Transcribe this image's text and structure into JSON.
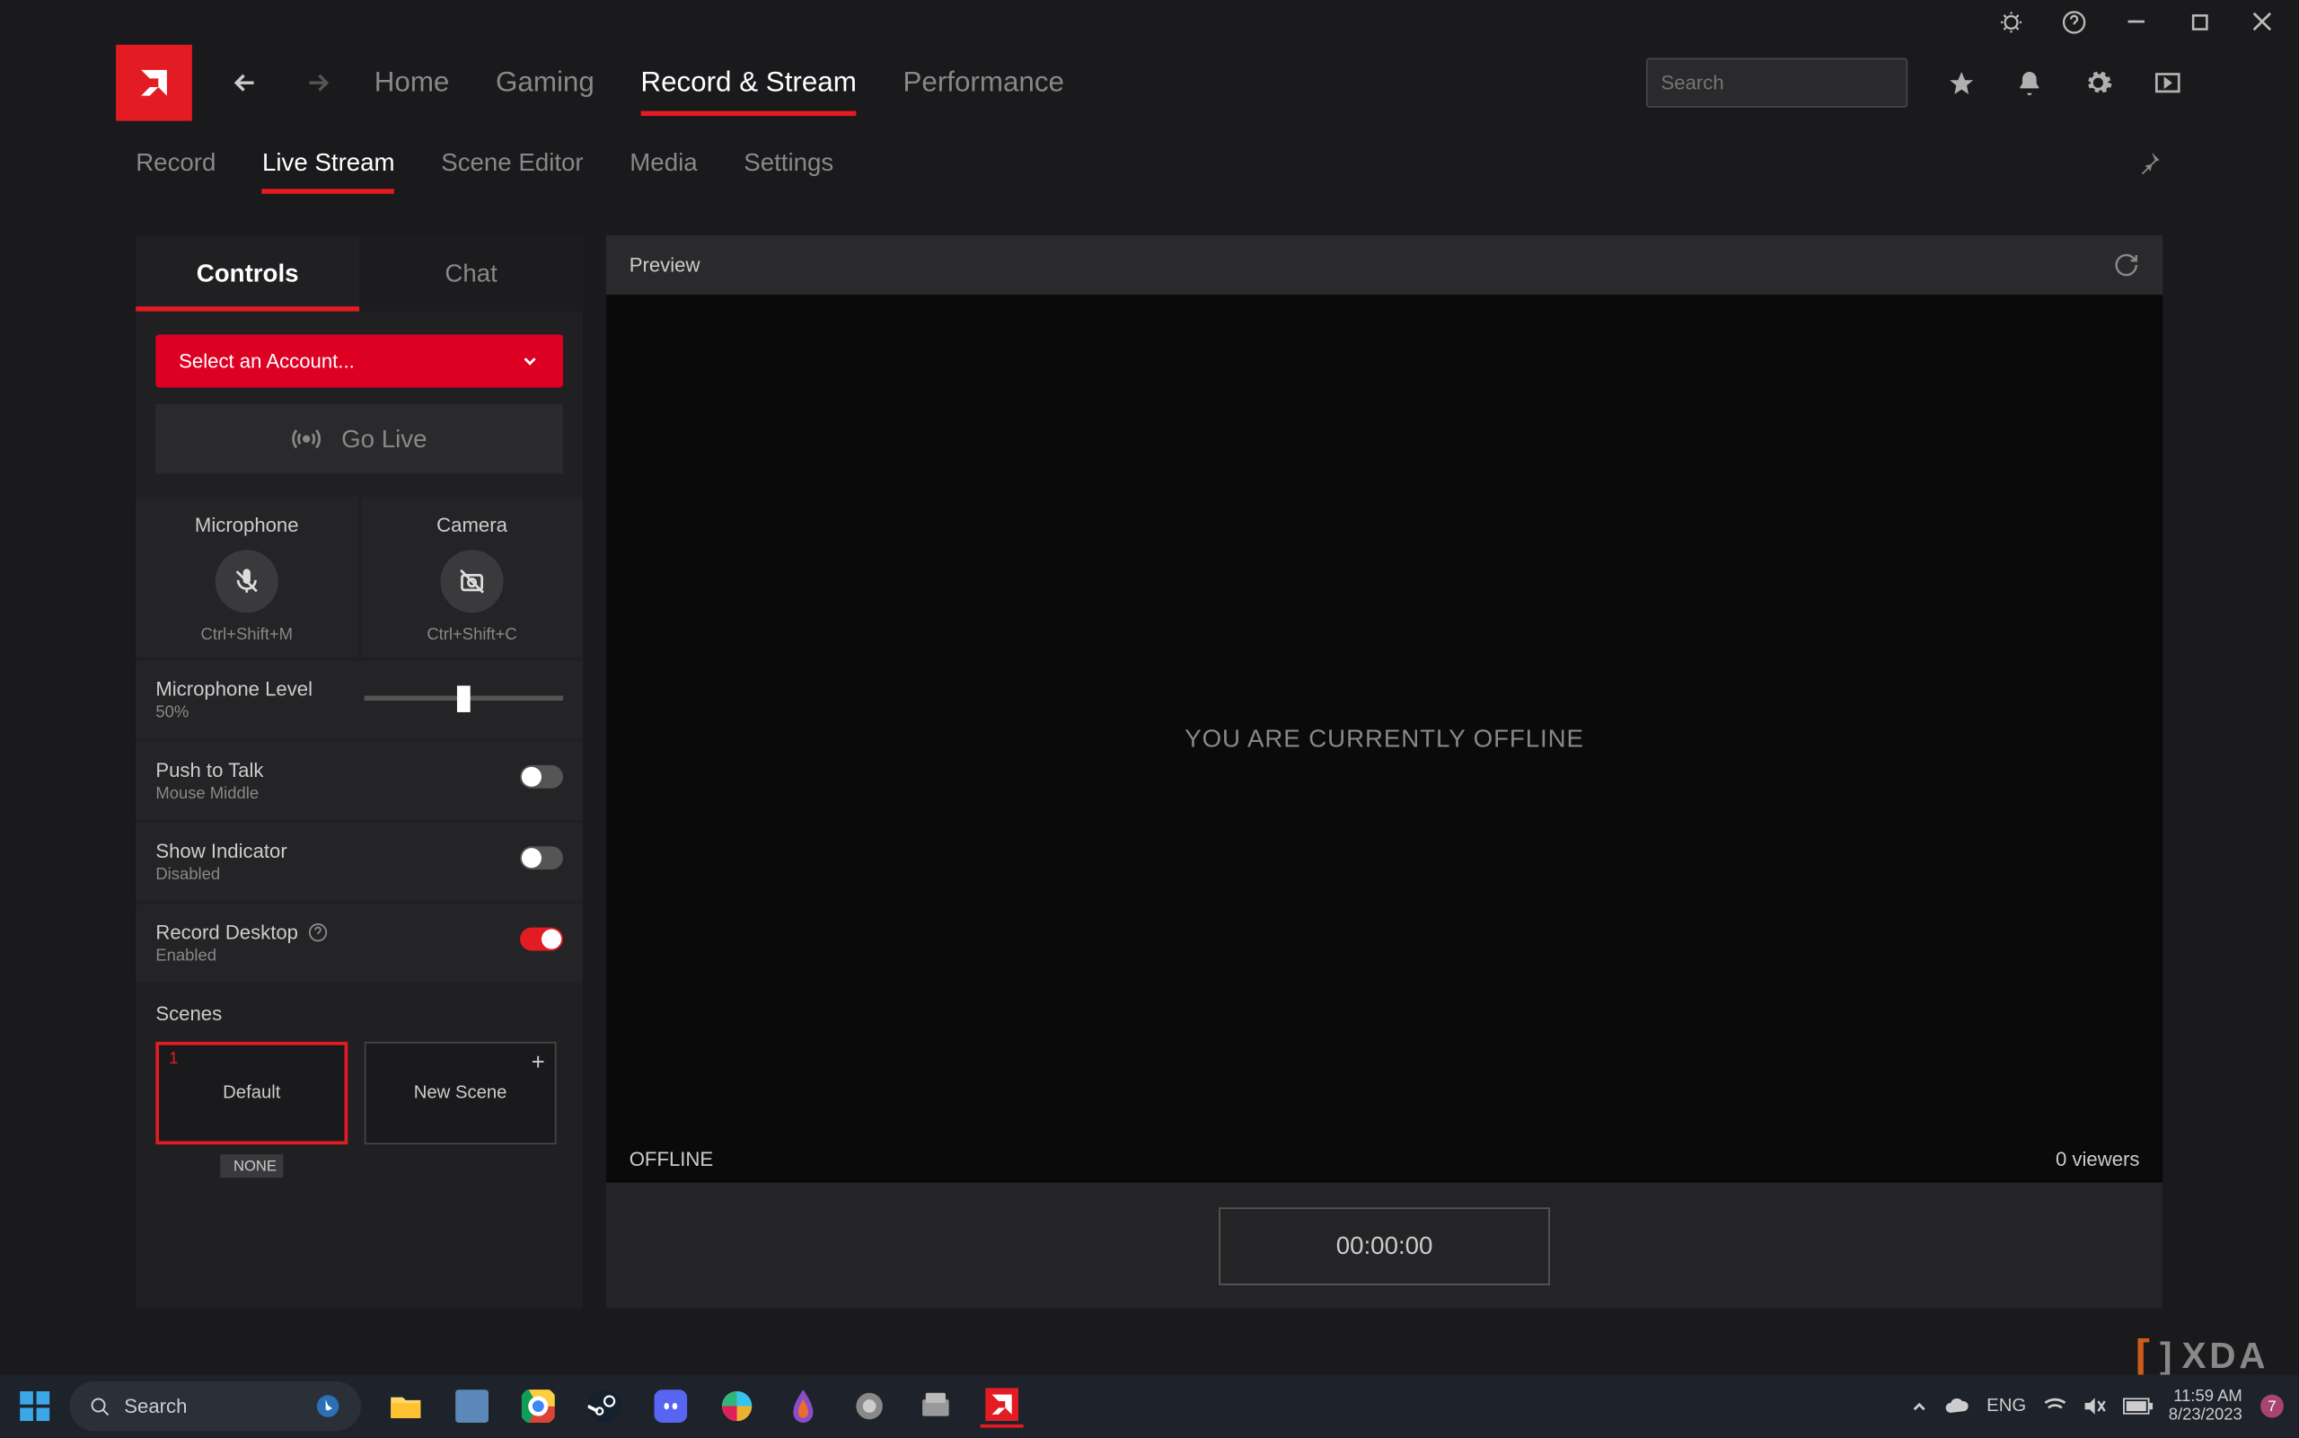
{
  "colors": {
    "accent": "#e31b23",
    "bg": "#1a1a1c",
    "panel": "#242426"
  },
  "titlebar": {
    "icons": [
      "bug",
      "help",
      "minimize",
      "maximize",
      "close"
    ]
  },
  "nav": {
    "links": [
      "Home",
      "Gaming",
      "Record & Stream",
      "Performance"
    ],
    "active": "Record & Stream",
    "search_placeholder": "Search"
  },
  "subnav": {
    "links": [
      "Record",
      "Live Stream",
      "Scene Editor",
      "Media",
      "Settings"
    ],
    "active": "Live Stream"
  },
  "sidebar": {
    "tabs": [
      "Controls",
      "Chat"
    ],
    "active_tab": "Controls",
    "account_select": "Select an Account...",
    "go_live": "Go Live",
    "devices": {
      "mic": {
        "label": "Microphone",
        "hotkey": "Ctrl+Shift+M",
        "muted": true
      },
      "cam": {
        "label": "Camera",
        "hotkey": "Ctrl+Shift+C",
        "muted": true
      }
    },
    "mic_level": {
      "label": "Microphone Level",
      "value_text": "50%",
      "value": 50
    },
    "push_to_talk": {
      "label": "Push to Talk",
      "sub": "Mouse Middle",
      "on": false
    },
    "show_indicator": {
      "label": "Show Indicator",
      "sub": "Disabled",
      "on": false
    },
    "record_desktop": {
      "label": "Record Desktop",
      "sub": "Enabled",
      "on": true
    },
    "scenes": {
      "label": "Scenes",
      "items": [
        {
          "num": "1",
          "name": "Default",
          "active": true,
          "tag": "NONE"
        },
        {
          "name": "New Scene",
          "add": true
        }
      ]
    }
  },
  "preview": {
    "header": "Preview",
    "offline_msg": "YOU ARE CURRENTLY OFFLINE",
    "status": "OFFLINE",
    "viewers": "0 viewers",
    "timer": "00:00:00"
  },
  "taskbar": {
    "search_placeholder": "Search",
    "lang": "ENG",
    "time": "11:59 AM",
    "date": "8/23/2023"
  },
  "watermark": "XDA"
}
